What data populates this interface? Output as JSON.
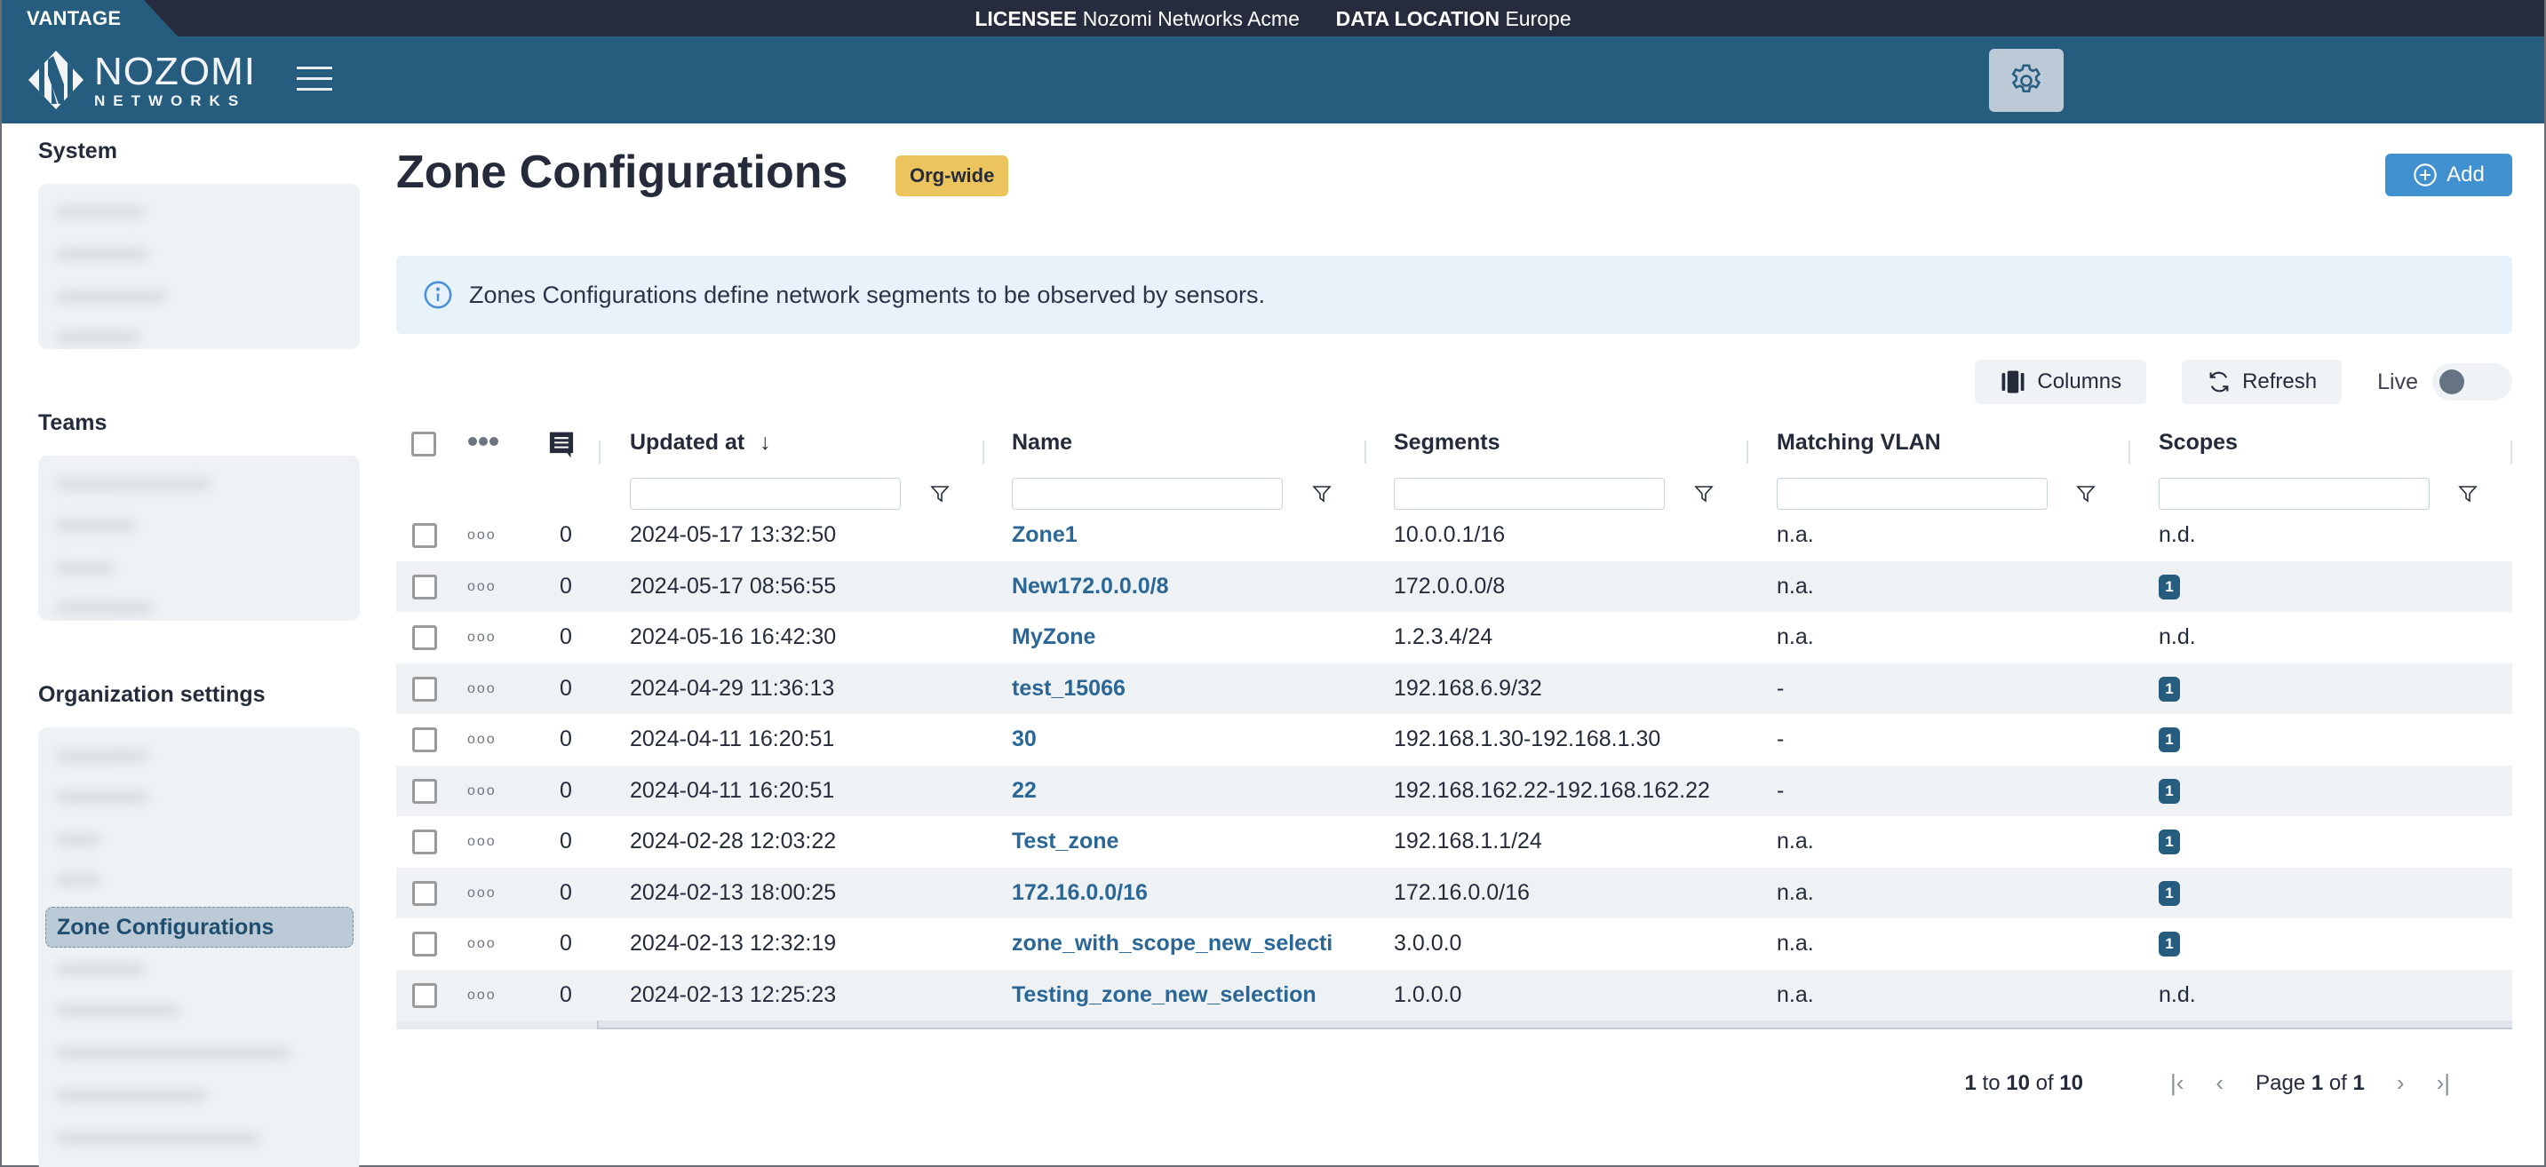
{
  "topbar": {
    "product": "VANTAGE",
    "licensee_label": "LICENSEE",
    "licensee_value": "Nozomi Networks Acme",
    "data_location_label": "DATA LOCATION",
    "data_location_value": "Europe"
  },
  "header": {
    "logo_line1": "NOZOMI",
    "logo_line2": "NETWORKS"
  },
  "sidebar": {
    "sections": [
      {
        "heading": "System"
      },
      {
        "heading": "Teams"
      },
      {
        "heading": "Organization settings"
      }
    ],
    "active_item": "Zone Configurations"
  },
  "page": {
    "title": "Zone Configurations",
    "badge": "Org-wide",
    "add_label": "Add",
    "info_text": "Zones Configurations define network segments to be observed by sensors."
  },
  "toolbar": {
    "columns_label": "Columns",
    "refresh_label": "Refresh",
    "live_label": "Live",
    "live_enabled": false
  },
  "table": {
    "columns": [
      "Updated at",
      "Name",
      "Segments",
      "Matching VLAN",
      "Scopes"
    ],
    "sort": {
      "column": "Updated at",
      "direction": "desc"
    },
    "rows": [
      {
        "comments": "0",
        "updated_at": "2024-05-17 13:32:50",
        "name": "Zone1",
        "segments": "10.0.0.1/16",
        "vlan": "n.a.",
        "scopes": "n.d.",
        "scopes_badge": false
      },
      {
        "comments": "0",
        "updated_at": "2024-05-17 08:56:55",
        "name": "New172.0.0.0/8",
        "segments": "172.0.0.0/8",
        "vlan": "n.a.",
        "scopes": "1",
        "scopes_badge": true
      },
      {
        "comments": "0",
        "updated_at": "2024-05-16 16:42:30",
        "name": "MyZone",
        "segments": "1.2.3.4/24",
        "vlan": "n.a.",
        "scopes": "n.d.",
        "scopes_badge": false
      },
      {
        "comments": "0",
        "updated_at": "2024-04-29 11:36:13",
        "name": "test_15066",
        "segments": "192.168.6.9/32",
        "vlan": "-",
        "scopes": "1",
        "scopes_badge": true
      },
      {
        "comments": "0",
        "updated_at": "2024-04-11 16:20:51",
        "name": "30",
        "segments": "192.168.1.30-192.168.1.30",
        "vlan": "-",
        "scopes": "1",
        "scopes_badge": true
      },
      {
        "comments": "0",
        "updated_at": "2024-04-11 16:20:51",
        "name": "22",
        "segments": "192.168.162.22-192.168.162.22",
        "vlan": "-",
        "scopes": "1",
        "scopes_badge": true
      },
      {
        "comments": "0",
        "updated_at": "2024-02-28 12:03:22",
        "name": "Test_zone",
        "segments": "192.168.1.1/24",
        "vlan": "n.a.",
        "scopes": "1",
        "scopes_badge": true
      },
      {
        "comments": "0",
        "updated_at": "2024-02-13 18:00:25",
        "name": "172.16.0.0/16",
        "segments": "172.16.0.0/16",
        "vlan": "n.a.",
        "scopes": "1",
        "scopes_badge": true
      },
      {
        "comments": "0",
        "updated_at": "2024-02-13 12:32:19",
        "name": "zone_with_scope_new_selecti",
        "segments": "3.0.0.0",
        "vlan": "n.a.",
        "scopes": "1",
        "scopes_badge": true
      },
      {
        "comments": "0",
        "updated_at": "2024-02-13 12:25:23",
        "name": "Testing_zone_new_selection",
        "segments": "1.0.0.0",
        "vlan": "n.a.",
        "scopes": "n.d.",
        "scopes_badge": false
      }
    ]
  },
  "pagination": {
    "from": "1",
    "to_word": "to",
    "to": "10",
    "of_word": "of",
    "total": "10",
    "page_word": "Page",
    "page": "1",
    "pages": "1"
  },
  "colors": {
    "brand_blue": "#265c7e",
    "topbar_dark": "#262c3d",
    "accent_button": "#4190cf",
    "badge_yellow": "#ebc45e",
    "link_blue": "#2a6796"
  }
}
